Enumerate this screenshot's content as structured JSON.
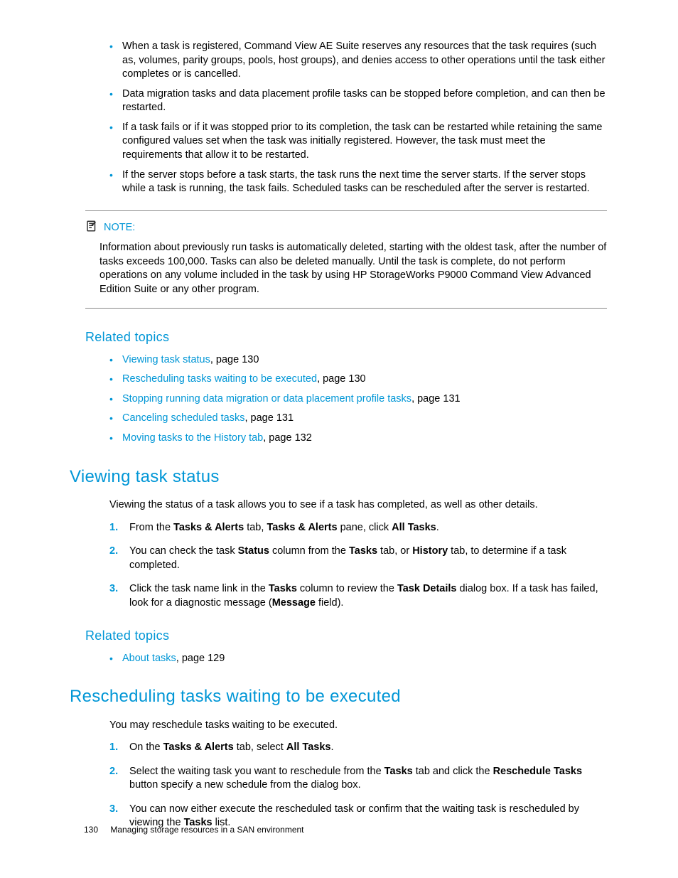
{
  "bullets_top": [
    "When a task is registered, Command View AE Suite reserves any resources that the task requires (such as, volumes, parity groups, pools, host groups), and denies access to other operations until the task either completes or is cancelled.",
    "Data migration tasks and data placement profile tasks can be stopped before completion, and can then be restarted.",
    "If a task fails or if it was stopped prior to its completion, the task can be restarted while retaining the same configured values set when the task was initially registered. However, the task must meet the requirements that allow it to be restarted.",
    "If the server stops before a task starts, the task runs the next time the server starts. If the server stops while a task is running, the task fails. Scheduled tasks can be rescheduled after the server is restarted."
  ],
  "note": {
    "label": "NOTE:",
    "body": "Information about previously run tasks is automatically deleted, starting with the oldest task, after the number of tasks exceeds 100,000. Tasks can also be deleted manually. Until the task is complete, do not perform operations on any volume included in the task by using HP StorageWorks P9000 Command View Advanced Edition Suite or any other program."
  },
  "related1": {
    "heading": "Related topics",
    "items": [
      {
        "link": "Viewing task status",
        "suffix": ", page 130"
      },
      {
        "link": "Rescheduling tasks waiting to be executed",
        "suffix": ", page 130"
      },
      {
        "link": "Stopping running data migration or data placement profile tasks",
        "suffix": ", page 131"
      },
      {
        "link": "Canceling scheduled tasks",
        "suffix": ", page 131"
      },
      {
        "link": "Moving tasks to the History tab",
        "suffix": ", page 132"
      }
    ]
  },
  "section1": {
    "heading": "Viewing task status",
    "intro": "Viewing the status of a task allows you to see if a task has completed, as well as other details.",
    "steps_html": [
      "From the <b>Tasks & Alerts</b> tab, <b>Tasks & Alerts</b> pane, click <b>All Tasks</b>.",
      "You can check the task <b>Status</b> column from the <b>Tasks</b> tab, or <b>History</b> tab, to determine if a task completed.",
      "Click the task name link in the <b>Tasks</b> column to review the <b>Task Details</b> dialog box. If a task has failed, look for a diagnostic message (<b>Message</b> field)."
    ]
  },
  "related2": {
    "heading": "Related topics",
    "items": [
      {
        "link": "About tasks",
        "suffix": ", page 129"
      }
    ]
  },
  "section2": {
    "heading": "Rescheduling tasks waiting to be executed",
    "intro": "You may reschedule tasks waiting to be executed.",
    "steps_html": [
      "On the <b>Tasks & Alerts</b> tab, select <b>All Tasks</b>.",
      "Select the waiting task you want to reschedule from the <b>Tasks</b> tab and click the <b>Reschedule Tasks</b> button specify a new schedule from the dialog box.",
      "You can now either execute the rescheduled task or confirm that the waiting task is rescheduled by viewing the <b>Tasks</b> list."
    ]
  },
  "footer": {
    "page": "130",
    "title": "Managing storage resources in a SAN environment"
  }
}
